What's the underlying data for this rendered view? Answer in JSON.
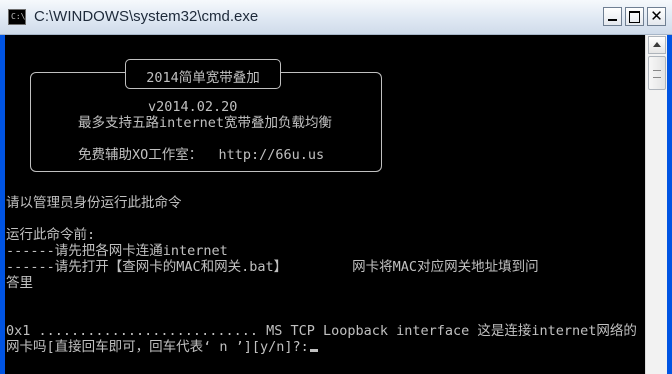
{
  "window": {
    "title": "C:\\WINDOWS\\system32\\cmd.exe",
    "icon_label": "C:\\",
    "close_glyph": "✕"
  },
  "console": {
    "box_title": "2014简单宽带叠加",
    "version": "v2014.02.20",
    "description": "最多支持五路internet宽带叠加负载均衡",
    "credits": "免费辅助XO工作室：  http://66u.us",
    "admin_notice": "请以管理员身份运行此批命令",
    "pre_run_header": "运行此命令前:",
    "step1": "------请先把各网卡连通internet",
    "step2": "------请先打开【查网卡的MAC和网关.bat】        网卡将MAC对应网关地址填到问",
    "step2_wrap": "答里",
    "interface_line": "0x1 ........................... MS TCP Loopback interface 这是连接internet网络的",
    "prompt_line": "网卡吗[直接回车即可，回车代表‘ n ’][y/n]?:"
  },
  "colors": {
    "console_bg": "#000000",
    "console_fg": "#c0c0c0",
    "title_bar": "#dfe8f3"
  }
}
